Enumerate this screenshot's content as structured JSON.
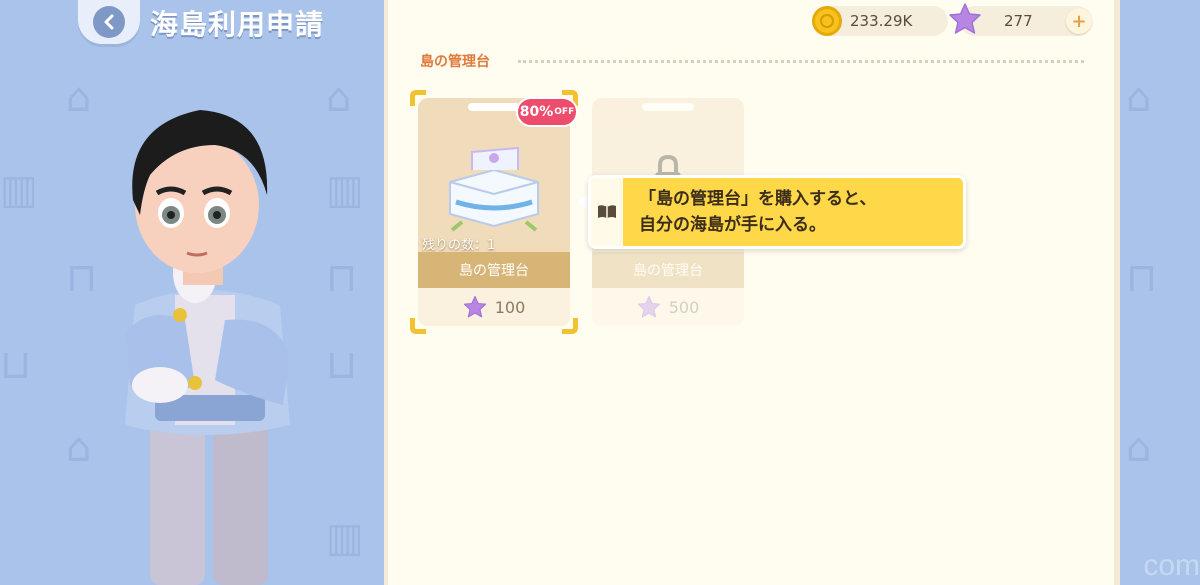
{
  "header": {
    "back_label": "",
    "title": "海島利用申請"
  },
  "currency": {
    "coins": "233.29K",
    "stars": "277",
    "add_label": "+"
  },
  "section": {
    "title": "島の管理台"
  },
  "items": [
    {
      "name": "島の管理台",
      "remaining": "残りの数：1",
      "price": "100",
      "discount": "80%",
      "discount_suffix": "OFF"
    },
    {
      "name": "島の管理台",
      "price": "500"
    }
  ],
  "tooltip": {
    "line1": "「島の管理台」を購入すると、",
    "line2": "自分の海島が手に入る。"
  },
  "watermark": "com",
  "colors": {
    "accent_orange": "#e07a3c",
    "tooltip_yellow": "#ffd84a",
    "badge_pink": "#ee4c6c",
    "panel_bg": "#fffcf0",
    "page_bg": "#aac3ea"
  }
}
